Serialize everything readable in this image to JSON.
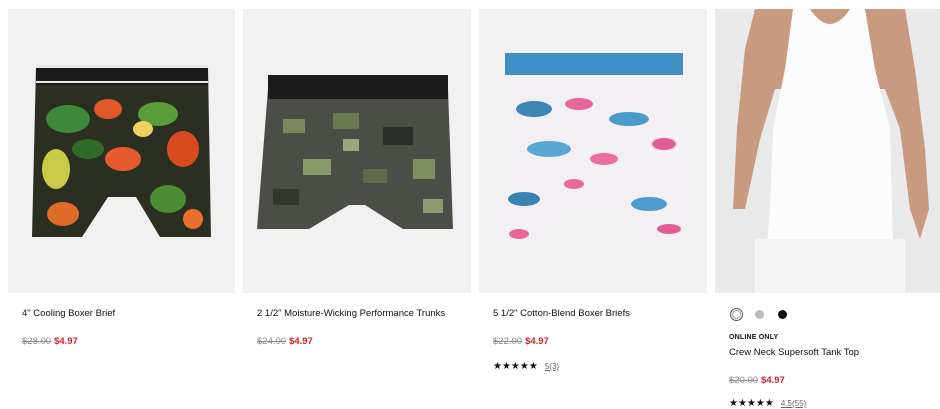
{
  "products": [
    {
      "name": "4\" Cooling Boxer Brief",
      "original_price": "$28.00",
      "sale_price": "$4.97",
      "image_icon": "floral-boxer-brief-image"
    },
    {
      "name": "2 1/2\" Moisture-Wicking Performance Trunks",
      "original_price": "$24.00",
      "sale_price": "$4.97",
      "image_icon": "camo-trunks-image"
    },
    {
      "name": "5 1/2\" Cotton-Blend Boxer Briefs",
      "original_price": "$22.00",
      "sale_price": "$4.97",
      "stars": "★★★★★",
      "review_count": "5(3)",
      "image_icon": "flamingo-boxer-brief-image"
    },
    {
      "name": "Crew Neck Supersoft Tank Top",
      "tag": "ONLINE ONLY",
      "original_price": "$20.00",
      "sale_price": "$4.97",
      "stars": "★★★★★",
      "review_count": "4.5(55)",
      "swatches": [
        "#ffffff",
        "#bdbdbd",
        "#111111"
      ],
      "image_icon": "white-tank-top-model-image"
    }
  ],
  "colors": {
    "sale": "#d0212f",
    "strike": "#8a8a8a",
    "image_bg": "#f1f1f1"
  }
}
